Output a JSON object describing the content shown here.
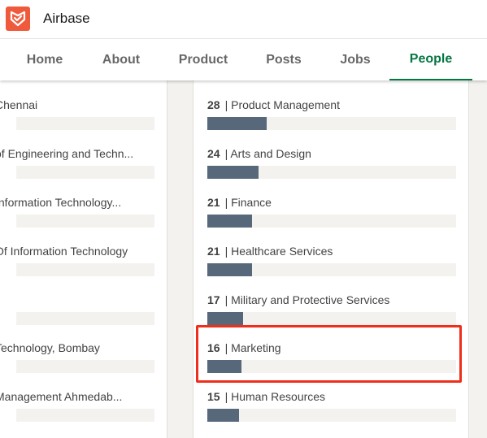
{
  "header": {
    "company_name": "Airbase",
    "logo_icon": "airbase-logo-icon",
    "brand_color": "#f05a3c"
  },
  "nav": {
    "tabs": [
      {
        "label": "Home"
      },
      {
        "label": "About"
      },
      {
        "label": "Product"
      },
      {
        "label": "Posts"
      },
      {
        "label": "Jobs"
      },
      {
        "label": "People",
        "active": true
      }
    ],
    "active_color": "#057642"
  },
  "schools": {
    "items": [
      {
        "label": "Chennai"
      },
      {
        "label": "of Engineering and Techn..."
      },
      {
        "label": "Information Technology..."
      },
      {
        "label": "Of Information Technology"
      },
      {
        "label": ""
      },
      {
        "label": "Technology, Bombay"
      },
      {
        "label": "Management Ahmedab..."
      }
    ]
  },
  "functions": {
    "items": [
      {
        "count": "28",
        "label": "Product Management",
        "fraction": 0.24
      },
      {
        "count": "24",
        "label": "Arts and Design",
        "fraction": 0.205
      },
      {
        "count": "21",
        "label": "Finance",
        "fraction": 0.18
      },
      {
        "count": "21",
        "label": "Healthcare Services",
        "fraction": 0.18
      },
      {
        "count": "17",
        "label": "Military and Protective Services",
        "fraction": 0.145
      },
      {
        "count": "16",
        "label": "Marketing",
        "fraction": 0.137,
        "highlighted": true
      },
      {
        "count": "15",
        "label": "Human Resources",
        "fraction": 0.128
      }
    ],
    "bar_color": "#56687a",
    "track_color": "#f3f2ef",
    "highlight_color": "#ef2f1b"
  }
}
